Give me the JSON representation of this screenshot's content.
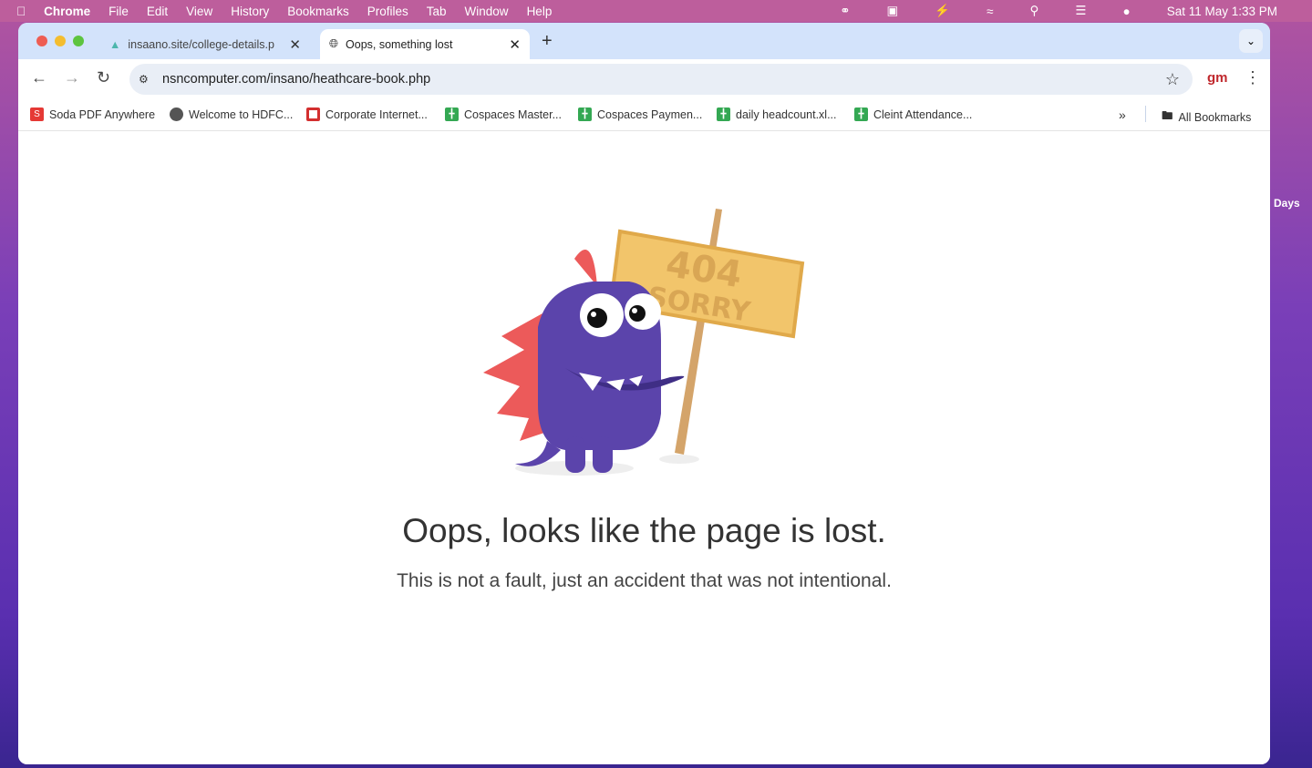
{
  "menubar": {
    "app": "Chrome",
    "items": [
      "File",
      "Edit",
      "View",
      "History",
      "Bookmarks",
      "Profiles",
      "Tab",
      "Window",
      "Help"
    ],
    "datetime": "Sat 11 May  1:33 PM"
  },
  "tabs": [
    {
      "title": "insaano.site/college-details.p",
      "active": false
    },
    {
      "title": "Oops, something lost",
      "active": true
    }
  ],
  "address": {
    "url": "nsncomputer.com/insano/heathcare-book.php"
  },
  "profile": "gm",
  "bookmarks": [
    {
      "label": "Soda PDF Anywhere",
      "icon": "soda-pdf-icon",
      "color": "#e53935"
    },
    {
      "label": "Welcome to HDFC...",
      "icon": "globe-icon",
      "color": "#555555"
    },
    {
      "label": "Corporate Internet...",
      "icon": "hdfc-icon",
      "color": "#d32f2f"
    },
    {
      "label": "Cospaces Master...",
      "icon": "sheets-icon",
      "color": "#34a853"
    },
    {
      "label": "Cospaces Paymen...",
      "icon": "sheets-icon",
      "color": "#34a853"
    },
    {
      "label": "daily headcount.xl...",
      "icon": "sheets-icon",
      "color": "#34a853"
    },
    {
      "label": "Cleint Attendance...",
      "icon": "sheets-icon",
      "color": "#34a853"
    }
  ],
  "all_bookmarks": "All Bookmarks",
  "page": {
    "sign_line1": "404",
    "sign_line2": "SORRY",
    "heading": "Oops, looks like the page is lost.",
    "message": "This is not a fault, just an accident that was not intentional."
  },
  "desktop": {
    "label": "Days"
  }
}
